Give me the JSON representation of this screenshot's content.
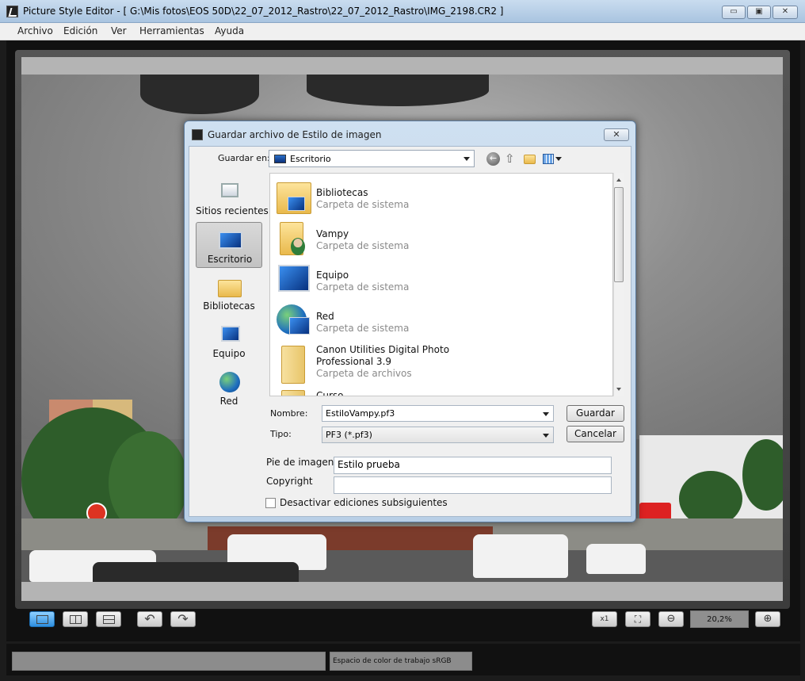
{
  "window": {
    "title": "Picture Style Editor - [ G:\\Mis fotos\\EOS 50D\\22_07_2012_Rastro\\22_07_2012_Rastro\\IMG_2198.CR2 ]",
    "minimize": "▭",
    "maximize": "▣",
    "close": "✕"
  },
  "menu": [
    "Archivo",
    "Edición",
    "Ver",
    "Herramientas",
    "Ayuda"
  ],
  "toolbar": {
    "zoom_value": "20,2%",
    "zoom_reset": "x1"
  },
  "status": {
    "left": "",
    "right": "Espacio de color de trabajo sRGB"
  },
  "dialog": {
    "title": "Guardar archivo de Estilo de imagen",
    "close": "✕",
    "look_in_label": "Guardar en:",
    "look_in_value": "Escritorio",
    "places": [
      {
        "label": "Sitios recientes",
        "icon": "recent-places-icon"
      },
      {
        "label": "Escritorio",
        "icon": "desktop-icon",
        "selected": true
      },
      {
        "label": "Bibliotecas",
        "icon": "libraries-icon"
      },
      {
        "label": "Equipo",
        "icon": "computer-icon"
      },
      {
        "label": "Red",
        "icon": "network-icon"
      }
    ],
    "files": [
      {
        "name": "Bibliotecas",
        "desc": "Carpeta de sistema",
        "icon": "libraries-folder-icon"
      },
      {
        "name": "Vampy",
        "desc": "Carpeta de sistema",
        "icon": "user-folder-icon"
      },
      {
        "name": "Equipo",
        "desc": "Carpeta de sistema",
        "icon": "computer-icon"
      },
      {
        "name": "Red",
        "desc": "Carpeta de sistema",
        "icon": "network-icon"
      },
      {
        "name": "Canon Utilities Digital Photo",
        "name2": "Professional 3.9",
        "desc": "Carpeta de archivos",
        "icon": "folder-icon"
      },
      {
        "name": "Curso",
        "desc": "",
        "icon": "folder-icon"
      }
    ],
    "filename_label": "Nombre:",
    "filename_value": "EstiloVampy.pf3",
    "type_label": "Tipo:",
    "type_value": "PF3 (*.pf3)",
    "save_button": "Guardar",
    "cancel_button": "Cancelar",
    "caption_label": "Pie de imagen",
    "caption_value": "Estilo prueba",
    "copyright_label": "Copyright",
    "copyright_value": "",
    "disable_edits_label": "Desactivar ediciones subsiguientes",
    "disable_edits_checked": false
  },
  "colors": {
    "titlebar": "#bcd2ea",
    "accent": "#2e8fe0",
    "workspace": "#111111"
  }
}
